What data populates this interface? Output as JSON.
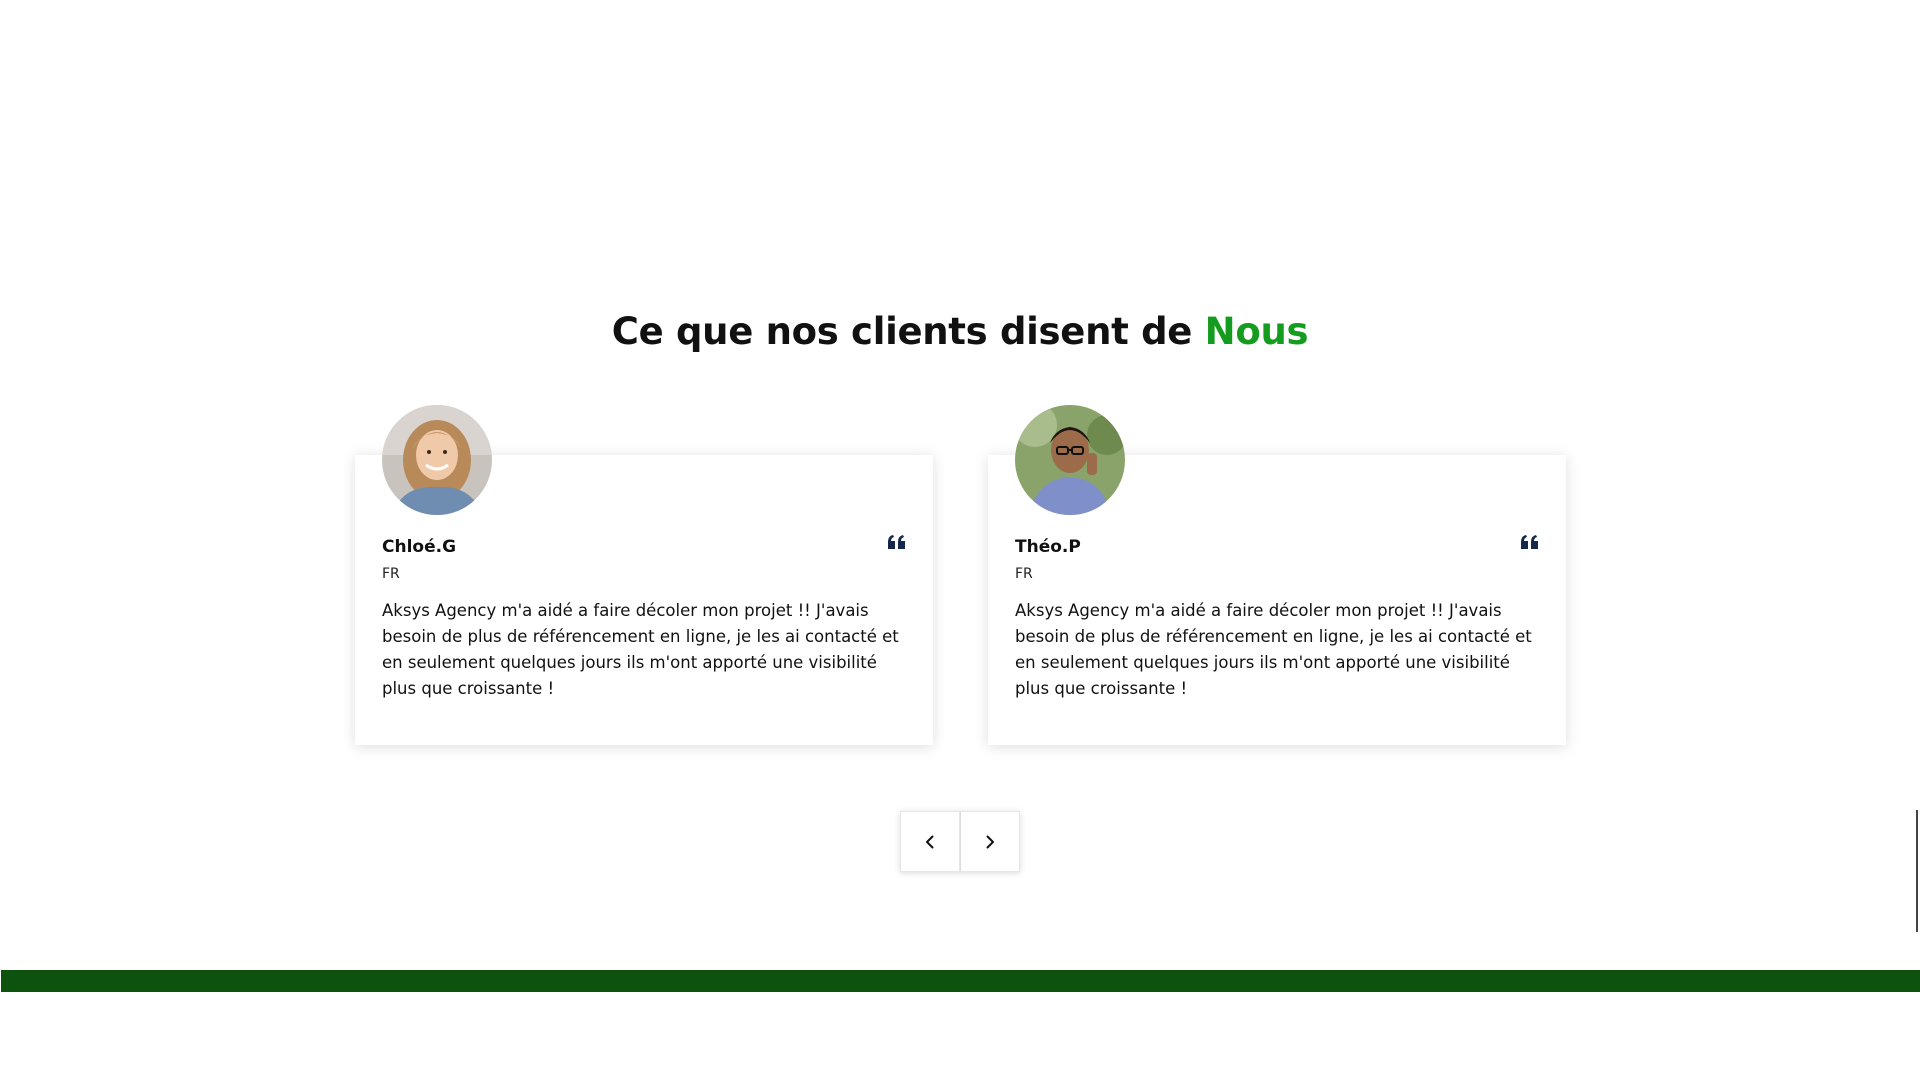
{
  "section": {
    "title_main": "Ce que nos clients disent de",
    "title_accent": "Nous",
    "accent_color": "#149c1e"
  },
  "testimonials": [
    {
      "name": "Chloé.G",
      "country": "FR",
      "text": "Aksys Agency m'a aidé a faire décoler mon projet !! J'avais besoin de plus de référencement en ligne, je les ai contacté et en seulement quelques jours ils m'ont apporté une visibilité plus que croissante !",
      "avatar": "woman-portrait-photo",
      "quote_icon": "quote-left-icon"
    },
    {
      "name": "Théo.P",
      "country": "FR",
      "text": "Aksys Agency m'a aidé a faire décoler mon projet !! J'avais besoin de plus de référencement en ligne, je les ai contacté et en seulement quelques jours ils m'ont apporté une visibilité plus que croissante !",
      "avatar": "man-portrait-photo",
      "quote_icon": "quote-left-icon"
    }
  ],
  "carousel_nav": {
    "prev_icon": "chevron-left-icon",
    "next_icon": "chevron-right-icon"
  },
  "footer": {
    "bar_color": "#0e530d"
  }
}
